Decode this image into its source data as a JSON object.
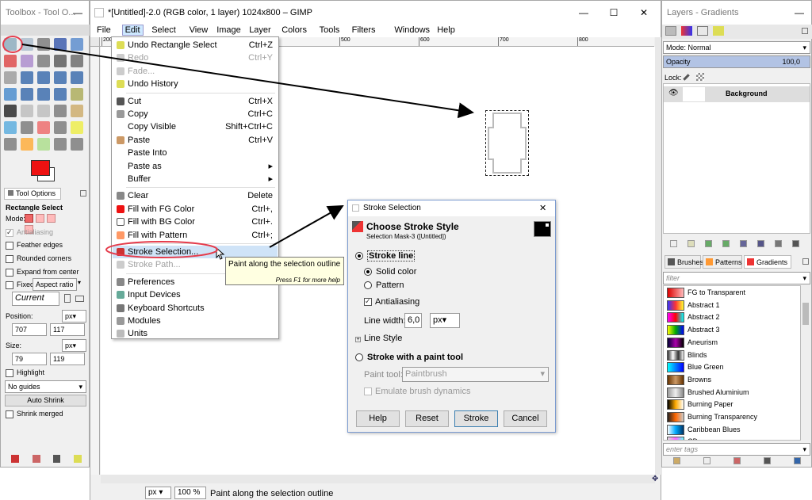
{
  "toolbox": {
    "title": "Toolbox - Tool O...",
    "minimize": "—",
    "tool_options_tab": "Tool Options",
    "tool_name": "Rectangle Select",
    "mode_label": "Mode:",
    "antialiasing": "Antialiasing",
    "feather": "Feather edges",
    "rounded": "Rounded corners",
    "expand": "Expand from center",
    "fixed": "Fixed:",
    "fixed_value": "Aspect ratio",
    "current": "Current",
    "position_label": "Position:",
    "pos_x": "707",
    "pos_y": "117",
    "pos_unit": "px",
    "size_label": "Size:",
    "size_w": "79",
    "size_h": "119",
    "size_unit": "px",
    "highlight": "Highlight",
    "guides": "No guides",
    "auto_shrink": "Auto Shrink",
    "shrink_merged": "Shrink merged"
  },
  "gimp": {
    "title": "*[Untitled]-2.0 (RGB color, 1 layer) 1024x800 – GIMP",
    "minimize": "—",
    "maximize": "☐",
    "close": "✕",
    "menubar": [
      "File",
      "Edit",
      "Select",
      "View",
      "Image",
      "Layer",
      "Colors",
      "Tools",
      "Filters",
      "Windows",
      "Help"
    ],
    "ruler_marks": [
      "200",
      "300",
      "400",
      "500",
      "600",
      "700",
      "800",
      "900"
    ],
    "status_unit": "px",
    "zoom": "100 %",
    "status_text": "Paint along the selection outline"
  },
  "edit_menu": {
    "items": [
      {
        "label": "Undo Rectangle Select",
        "shortcut": "Ctrl+Z",
        "icon": "undo-icon",
        "disabled": false
      },
      {
        "label": "Redo",
        "shortcut": "Ctrl+Y",
        "icon": "redo-icon",
        "disabled": true
      },
      {
        "label": "Fade...",
        "shortcut": "",
        "icon": "fade-icon",
        "disabled": true
      },
      {
        "label": "Undo History",
        "shortcut": "",
        "icon": "undo-history-icon",
        "disabled": false
      },
      {
        "label": "Cut",
        "shortcut": "Ctrl+X",
        "icon": "cut-icon",
        "disabled": false
      },
      {
        "label": "Copy",
        "shortcut": "Ctrl+C",
        "icon": "copy-icon",
        "disabled": false
      },
      {
        "label": "Copy Visible",
        "shortcut": "Shift+Ctrl+C",
        "icon": "",
        "disabled": false
      },
      {
        "label": "Paste",
        "shortcut": "Ctrl+V",
        "icon": "paste-icon",
        "disabled": false
      },
      {
        "label": "Paste Into",
        "shortcut": "",
        "icon": "",
        "disabled": false
      },
      {
        "label": "Paste as",
        "shortcut": "▸",
        "icon": "",
        "disabled": false
      },
      {
        "label": "Buffer",
        "shortcut": "▸",
        "icon": "",
        "disabled": false
      },
      {
        "label": "Clear",
        "shortcut": "Delete",
        "icon": "clear-icon",
        "disabled": false
      },
      {
        "label": "Fill with FG Color",
        "shortcut": "Ctrl+,",
        "icon": "fg-color-icon",
        "disabled": false
      },
      {
        "label": "Fill with BG Color",
        "shortcut": "Ctrl+.",
        "icon": "bg-color-icon",
        "disabled": false
      },
      {
        "label": "Fill with Pattern",
        "shortcut": "Ctrl+;",
        "icon": "pattern-icon",
        "disabled": false
      },
      {
        "label": "Stroke Selection...",
        "shortcut": "",
        "icon": "stroke-selection-icon",
        "disabled": false
      },
      {
        "label": "Stroke Path...",
        "shortcut": "",
        "icon": "stroke-path-icon",
        "disabled": true
      },
      {
        "label": "Preferences",
        "shortcut": "",
        "icon": "preferences-icon",
        "disabled": false
      },
      {
        "label": "Input Devices",
        "shortcut": "",
        "icon": "input-devices-icon",
        "disabled": false
      },
      {
        "label": "Keyboard Shortcuts",
        "shortcut": "",
        "icon": "keyboard-icon",
        "disabled": false
      },
      {
        "label": "Modules",
        "shortcut": "",
        "icon": "modules-icon",
        "disabled": false
      },
      {
        "label": "Units",
        "shortcut": "",
        "icon": "units-icon",
        "disabled": false
      }
    ]
  },
  "tooltip": {
    "text": "Paint along the selection outline",
    "hint": "Press F1 for more help"
  },
  "dialog": {
    "title": "Stroke Selection",
    "close": "✕",
    "heading": "Choose Stroke Style",
    "subheading": "Selection Mask-3 ([Untitled])",
    "stroke_line": "Stroke line",
    "solid_color": "Solid color",
    "pattern": "Pattern",
    "antialiasing": "Antialiasing",
    "line_width_label": "Line width:",
    "line_width": "6,0",
    "unit": "px",
    "line_style": "Line Style",
    "stroke_paint_tool": "Stroke with a paint tool",
    "paint_tool_label": "Paint tool:",
    "paint_tool": "Paintbrush",
    "emulate": "Emulate brush dynamics",
    "help": "Help",
    "reset": "Reset",
    "stroke": "Stroke",
    "cancel": "Cancel"
  },
  "layers": {
    "title": "Layers - Gradients",
    "minimize": "—",
    "mode": "Mode: Normal",
    "opacity_label": "Opacity",
    "opacity_value": "100,0",
    "lock_label": "Lock:",
    "layer_name": "Background",
    "tabs": [
      "Brushes",
      "Patterns",
      "Gradients"
    ],
    "filter_placeholder": "filter",
    "tags_placeholder": "enter tags",
    "gradients": [
      {
        "name": "FG to Transparent",
        "colors": "#d00,#fbb"
      },
      {
        "name": "Abstract 1",
        "colors": "#33f,#f33,#ff3"
      },
      {
        "name": "Abstract 2",
        "colors": "#f0f,#f00,#0ff"
      },
      {
        "name": "Abstract 3",
        "colors": "#ff0,#0a0,#00f"
      },
      {
        "name": "Aneurism",
        "colors": "#003,#a0a,#000"
      },
      {
        "name": "Blinds",
        "colors": "#333,#fff,#333,#fff"
      },
      {
        "name": "Blue Green",
        "colors": "#0ff,#00f"
      },
      {
        "name": "Browns",
        "colors": "#630,#c96,#630"
      },
      {
        "name": "Brushed Aluminium",
        "colors": "#999,#eee,#888"
      },
      {
        "name": "Burning Paper",
        "colors": "#000,#fa0,#fff"
      },
      {
        "name": "Burning Transparency",
        "colors": "#222,#f60,#ccc"
      },
      {
        "name": "Caribbean Blues",
        "colors": "#fff,#0af,#036"
      },
      {
        "name": "CD",
        "colors": "#ddd,#f6f,#6ff"
      }
    ]
  }
}
